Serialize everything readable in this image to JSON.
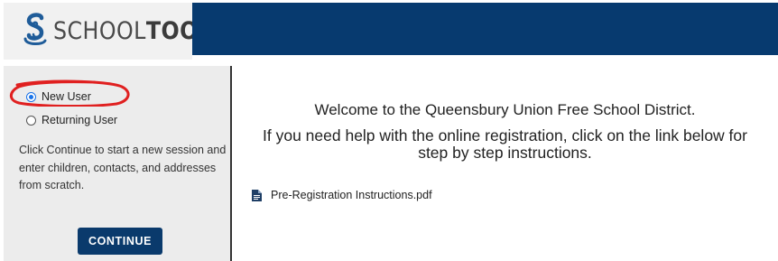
{
  "header": {
    "logo_text_light": "SCHOOL",
    "logo_text_bold": "TOOL",
    "band_color": "#073a6f"
  },
  "sidebar": {
    "options": [
      {
        "label": "New User",
        "checked": true
      },
      {
        "label": "Returning User",
        "checked": false
      }
    ],
    "description": "Click Continue to start a new session and enter children, contacts, and addresses from scratch.",
    "continue_label": "CONTINUE"
  },
  "main": {
    "welcome": "Welcome to the Queensbury Union Free School District.",
    "help_line_1": "If you need help with the online registration, click on the link below for",
    "help_line_2": "step by step instructions.",
    "file_link": "Pre-Registration Instructions.pdf"
  },
  "colors": {
    "accent": "#0a3a6c",
    "radio_selected": "#1a73e8",
    "annotation": "#e02020"
  },
  "icons": [
    "schooltool-logo-icon",
    "radio-button",
    "pdf-file-icon"
  ]
}
